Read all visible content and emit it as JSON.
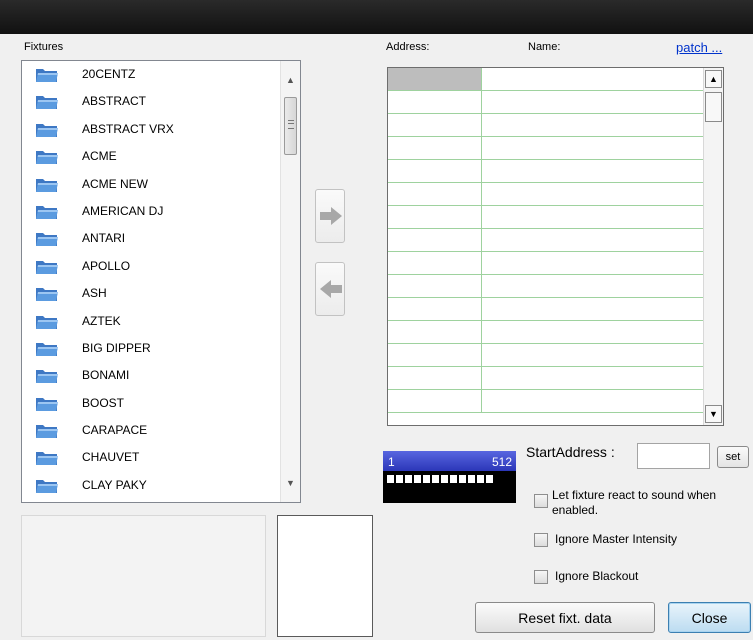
{
  "labels": {
    "fixtures": "Fixtures",
    "address": "Address:",
    "name": "Name:",
    "patch": "patch ..."
  },
  "fixtures": [
    "20CENTZ",
    "ABSTRACT",
    "ABSTRACT VRX",
    "ACME",
    "ACME NEW",
    "AMERICAN DJ",
    "ANTARI",
    "APOLLO",
    "ASH",
    "AZTEK",
    "BIG DIPPER",
    "BONAMI",
    "BOOST",
    "CARAPACE",
    "CHAUVET",
    "CLAY PAKY"
  ],
  "address_grid": {
    "row_count": 15,
    "selected_row": 0
  },
  "dmx": {
    "start": "1",
    "end": "512",
    "segments": 12
  },
  "start_address": {
    "label": "StartAddress :",
    "value": "",
    "set_label": "set"
  },
  "options": {
    "react_sound": "Let fixture react to sound when enabled.",
    "ignore_master": "Ignore Master Intensity",
    "ignore_blackout": "Ignore Blackout"
  },
  "buttons": {
    "reset": "Reset fixt. data",
    "close": "Close"
  },
  "colors": {
    "grid_line": "#9ed29e",
    "dmx_bar": "#3a46cc",
    "link": "#0033cc"
  },
  "icons": {
    "fixture_item": "folder-icon",
    "add": "arrow-right-icon",
    "remove": "arrow-left-icon"
  }
}
